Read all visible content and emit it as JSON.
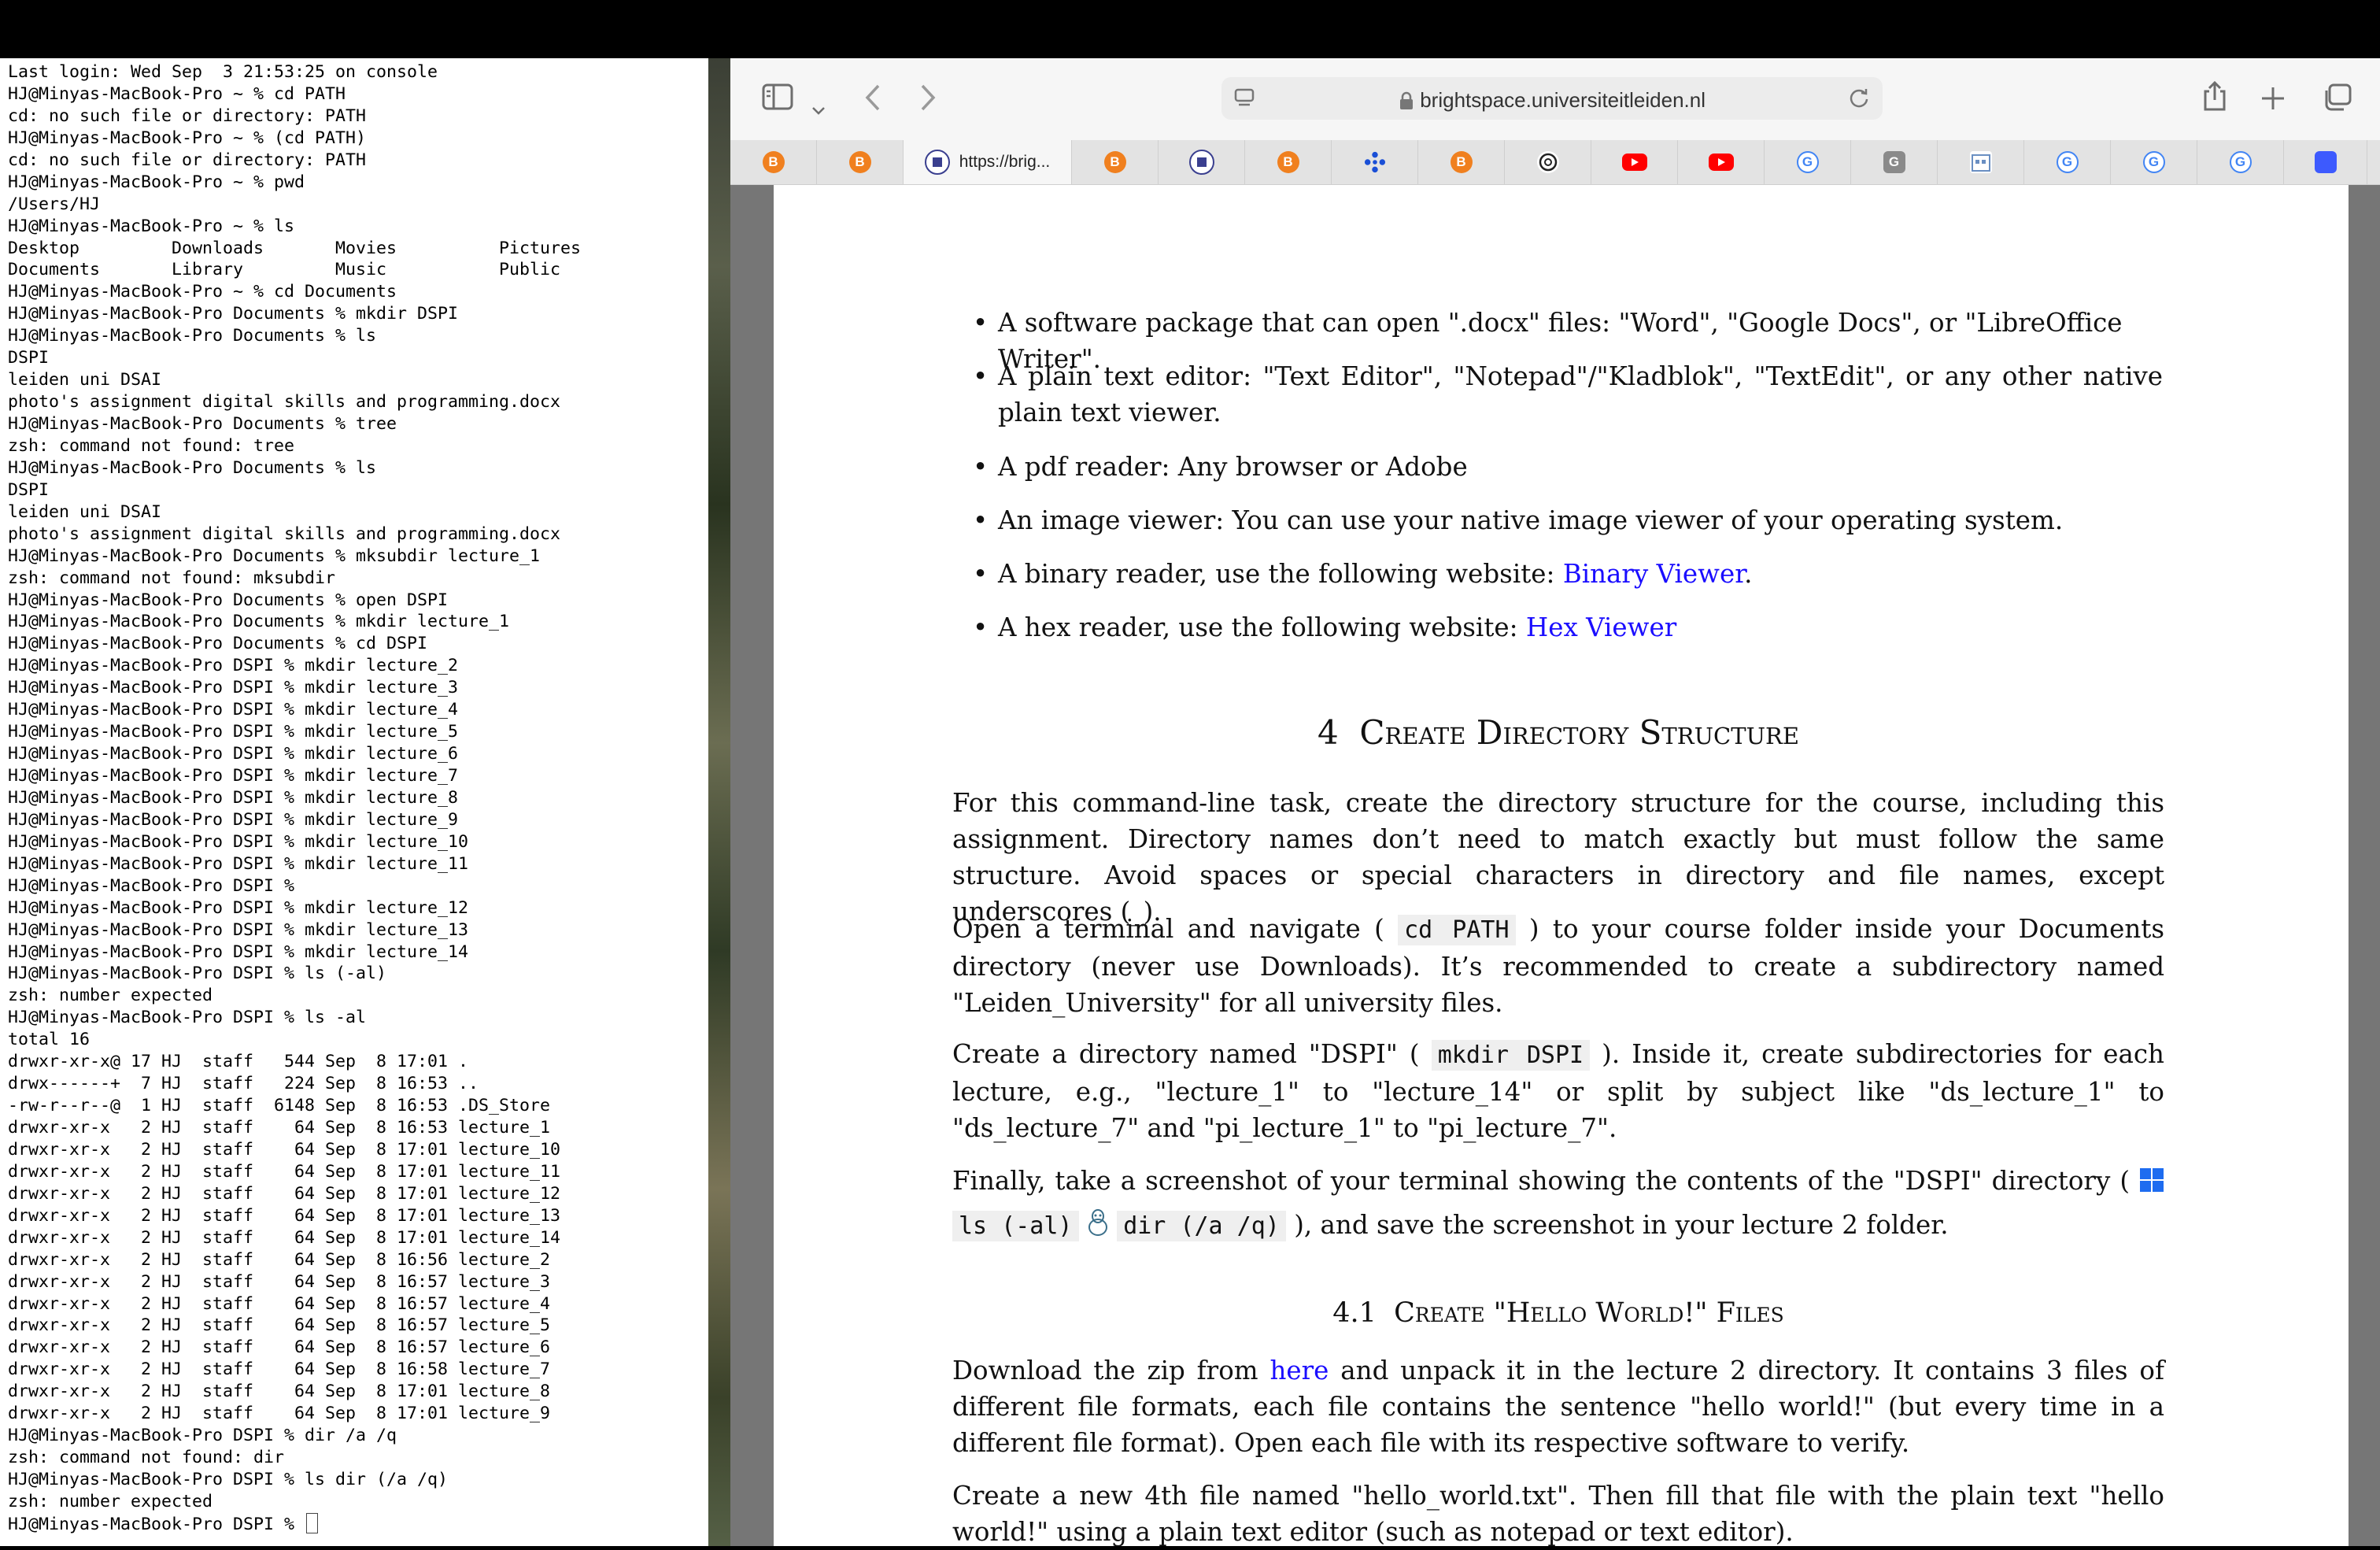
{
  "terminal": {
    "lines": [
      "Last login: Wed Sep  3 21:53:25 on console",
      "HJ@Minyas-MacBook-Pro ~ % cd PATH",
      "cd: no such file or directory: PATH",
      "HJ@Minyas-MacBook-Pro ~ % (cd PATH)",
      "cd: no such file or directory: PATH",
      "HJ@Minyas-MacBook-Pro ~ % pwd",
      "/Users/HJ",
      "HJ@Minyas-MacBook-Pro ~ % ls",
      "Desktop         Downloads       Movies          Pictures",
      "Documents       Library         Music           Public",
      "HJ@Minyas-MacBook-Pro ~ % cd Documents",
      "HJ@Minyas-MacBook-Pro Documents % mkdir DSPI",
      "HJ@Minyas-MacBook-Pro Documents % ls",
      "DSPI",
      "leiden uni DSAI",
      "photo's assignment digital skills and programming.docx",
      "HJ@Minyas-MacBook-Pro Documents % tree",
      "zsh: command not found: tree",
      "HJ@Minyas-MacBook-Pro Documents % ls",
      "DSPI",
      "leiden uni DSAI",
      "photo's assignment digital skills and programming.docx",
      "HJ@Minyas-MacBook-Pro Documents % mksubdir lecture_1",
      "zsh: command not found: mksubdir",
      "HJ@Minyas-MacBook-Pro Documents % open DSPI",
      "HJ@Minyas-MacBook-Pro Documents % mkdir lecture_1",
      "HJ@Minyas-MacBook-Pro Documents % cd DSPI",
      "HJ@Minyas-MacBook-Pro DSPI % mkdir lecture_2",
      "HJ@Minyas-MacBook-Pro DSPI % mkdir lecture_3",
      "HJ@Minyas-MacBook-Pro DSPI % mkdir lecture_4",
      "HJ@Minyas-MacBook-Pro DSPI % mkdir lecture_5",
      "HJ@Minyas-MacBook-Pro DSPI % mkdir lecture_6",
      "HJ@Minyas-MacBook-Pro DSPI % mkdir lecture_7",
      "HJ@Minyas-MacBook-Pro DSPI % mkdir lecture_8",
      "HJ@Minyas-MacBook-Pro DSPI % mkdir lecture_9",
      "HJ@Minyas-MacBook-Pro DSPI % mkdir lecture_10",
      "HJ@Minyas-MacBook-Pro DSPI % mkdir lecture_11",
      "HJ@Minyas-MacBook-Pro DSPI %",
      "HJ@Minyas-MacBook-Pro DSPI % mkdir lecture_12",
      "HJ@Minyas-MacBook-Pro DSPI % mkdir lecture_13",
      "HJ@Minyas-MacBook-Pro DSPI % mkdir lecture_14",
      "HJ@Minyas-MacBook-Pro DSPI % ls (-al)",
      "zsh: number expected",
      "HJ@Minyas-MacBook-Pro DSPI % ls -al",
      "total 16",
      "drwxr-xr-x@ 17 HJ  staff   544 Sep  8 17:01 .",
      "drwx------+  7 HJ  staff   224 Sep  8 16:53 ..",
      "-rw-r--r--@  1 HJ  staff  6148 Sep  8 16:53 .DS_Store",
      "drwxr-xr-x   2 HJ  staff    64 Sep  8 16:53 lecture_1",
      "drwxr-xr-x   2 HJ  staff    64 Sep  8 17:01 lecture_10",
      "drwxr-xr-x   2 HJ  staff    64 Sep  8 17:01 lecture_11",
      "drwxr-xr-x   2 HJ  staff    64 Sep  8 17:01 lecture_12",
      "drwxr-xr-x   2 HJ  staff    64 Sep  8 17:01 lecture_13",
      "drwxr-xr-x   2 HJ  staff    64 Sep  8 17:01 lecture_14",
      "drwxr-xr-x   2 HJ  staff    64 Sep  8 16:56 lecture_2",
      "drwxr-xr-x   2 HJ  staff    64 Sep  8 16:57 lecture_3",
      "drwxr-xr-x   2 HJ  staff    64 Sep  8 16:57 lecture_4",
      "drwxr-xr-x   2 HJ  staff    64 Sep  8 16:57 lecture_5",
      "drwxr-xr-x   2 HJ  staff    64 Sep  8 16:57 lecture_6",
      "drwxr-xr-x   2 HJ  staff    64 Sep  8 16:58 lecture_7",
      "drwxr-xr-x   2 HJ  staff    64 Sep  8 17:01 lecture_8",
      "drwxr-xr-x   2 HJ  staff    64 Sep  8 17:01 lecture_9",
      "HJ@Minyas-MacBook-Pro DSPI % dir /a /q",
      "zsh: command not found: dir",
      "HJ@Minyas-MacBook-Pro DSPI % ls dir (/a /q)",
      "zsh: number expected",
      "HJ@Minyas-MacBook-Pro DSPI % "
    ]
  },
  "browser": {
    "url": "brightspace.universiteitleiden.nl",
    "active_tab_title": "https://brig...",
    "tabs": [
      {
        "icon": "brightspace-icon",
        "color": "#f0801f",
        "glyph": "B"
      },
      {
        "icon": "brightspace-icon",
        "color": "#f0801f",
        "glyph": "B"
      },
      {
        "icon": "leiden-seal-icon",
        "color": "#3a3f8f",
        "glyph": "",
        "active": true
      },
      {
        "icon": "brightspace-icon",
        "color": "#f0801f",
        "glyph": "B"
      },
      {
        "icon": "leiden-seal-icon",
        "color": "#3a3f8f",
        "glyph": ""
      },
      {
        "icon": "brightspace-icon",
        "color": "#f0801f",
        "glyph": "B"
      },
      {
        "icon": "dots-cluster-icon",
        "color": "#1a4fd6",
        "glyph": ""
      },
      {
        "icon": "brightspace-icon",
        "color": "#f0801f",
        "glyph": "B"
      },
      {
        "icon": "openai-icon",
        "color": "#222222",
        "glyph": ""
      },
      {
        "icon": "youtube-icon",
        "color": "#ff0000",
        "glyph": ""
      },
      {
        "icon": "youtube-icon",
        "color": "#ff0000",
        "glyph": ""
      },
      {
        "icon": "google-icon",
        "color": "#4285f4",
        "glyph": "G"
      },
      {
        "icon": "google-grey-icon",
        "color": "#8a8a8a",
        "glyph": "G"
      },
      {
        "icon": "calendar-icon",
        "color": "#6a8fc2",
        "glyph": ""
      },
      {
        "icon": "google-icon",
        "color": "#4285f4",
        "glyph": "G"
      },
      {
        "icon": "google-icon",
        "color": "#4285f4",
        "glyph": "G"
      },
      {
        "icon": "google-icon",
        "color": "#4285f4",
        "glyph": "G"
      },
      {
        "icon": "app-square-icon",
        "color": "#3d5afe",
        "glyph": ""
      }
    ]
  },
  "doc": {
    "bullets": [
      "A software package that can open \".docx\" files: \"Word\", \"Google Docs\", or \"LibreOffice Writer\".",
      "A plain text editor:  \"Text Editor\", \"Notepad\"/\"Kladblok\", \"TextEdit\", or any other native plain text viewer.",
      "A pdf reader: Any browser or Adobe",
      "An image viewer: You can use your native image viewer of your operating system."
    ],
    "bullet_binary_prefix": "A binary reader, use the following website: ",
    "bullet_binary_link": "Binary Viewer",
    "bullet_binary_suffix": ".",
    "bullet_hex_prefix": "A hex reader, use the following website: ",
    "bullet_hex_link": "Hex Viewer",
    "section_number": "4",
    "section_title": "Create Directory Structure",
    "p1": "For this command-line task, create the directory structure for the course, including this assignment. Directory names don’t need to match exactly but must follow the same structure.  Avoid spaces or special characters in directory and file names, except underscores (_).",
    "p2_a": "Open a terminal and navigate ( ",
    "p2_code": "cd PATH",
    "p2_b": " ) to your course folder inside your Documents directory (never use Downloads).  It’s recommended to create a subdirectory named \"Leiden_University\" for all university files.",
    "p3_a": "Create a directory named \"DSPI\" ( ",
    "p3_code": "mkdir DSPI",
    "p3_b": " ). Inside it, create subdirectories for each lecture, e.g., \"lecture_1\" to \"lecture_14\" or split by subject like \"ds_lecture_1\" to \"ds_lecture_7\" and \"pi_lecture_1\" to \"pi_lecture_7\".",
    "p4_a": "Finally, take a screenshot of your terminal showing the contents of the \"DSPI\" directory ( ",
    "p4_code1": "ls (-al)",
    "p4_code2": "dir (/a /q)",
    "p4_b": " ), and save the screenshot in your lecture 2 folder.",
    "subsection_number": "4.1",
    "subsection_title": "Create \"Hello World!\" Files",
    "p5_a": "Download the zip from ",
    "p5_link": "here",
    "p5_b": " and unpack it in the lecture 2 directory. It contains 3 files of different file formats, each file contains the sentence \"hello world!\" (but every time in a different file format). Open each file with its respective software to verify.",
    "p6": "Create a new 4th file named \"hello_world.txt\". Then fill that file with the plain text \"hello world!\" using a plain text editor (such as notepad or text editor)."
  }
}
